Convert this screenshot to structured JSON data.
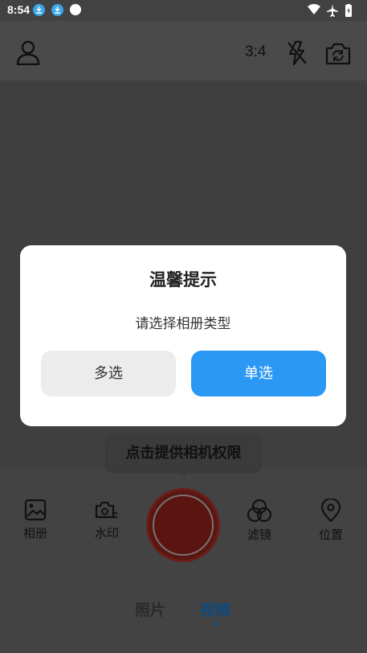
{
  "status_bar": {
    "time": "8:54",
    "icons": [
      "download-icon",
      "download-icon",
      "dot-icon",
      "wifi-icon",
      "airplane-icon",
      "battery-icon"
    ]
  },
  "top_bar": {
    "profile_icon": "person-icon",
    "aspect_ratio": "3:4",
    "flash_icon": "flash-off-icon",
    "switch_camera_icon": "camera-switch-icon"
  },
  "tools": [
    {
      "label": "相册",
      "icon": "gallery-icon"
    },
    {
      "label": "水印",
      "icon": "watermark-icon"
    },
    {
      "label": "滤镜",
      "icon": "filter-icon"
    },
    {
      "label": "位置",
      "icon": "location-icon"
    }
  ],
  "modes": {
    "photo": "照片",
    "video": "视频",
    "selected": "video"
  },
  "tooltip": {
    "text": "点击提供相机权限"
  },
  "dialog": {
    "title": "温馨提示",
    "message": "请选择相册类型",
    "btn_multi": "多选",
    "btn_single": "单选"
  },
  "colors": {
    "accent": "#2b98f4",
    "shutter": "#5b1510",
    "overlay": "#3f3f3f"
  }
}
